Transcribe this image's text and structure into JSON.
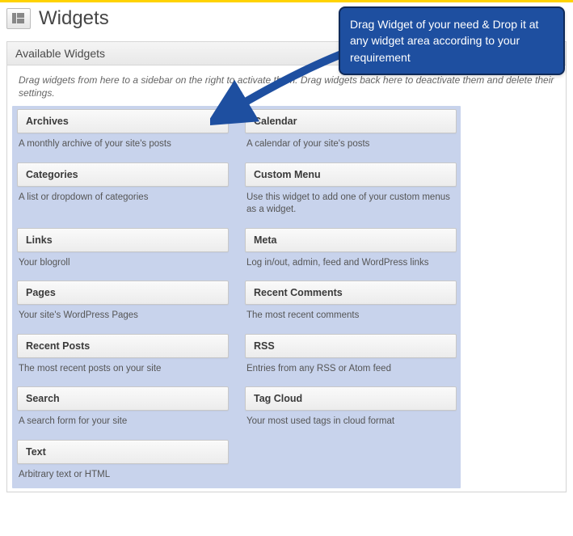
{
  "header": {
    "title": "Widgets"
  },
  "panel": {
    "title": "Available Widgets",
    "description": "Drag widgets from here to a sidebar on the right to activate them. Drag widgets back here to deactivate them and delete their settings."
  },
  "callout": {
    "text": "Drag Widget of your need & Drop it at any widget area according to your requirement"
  },
  "widgets": [
    {
      "title": "Archives",
      "desc": "A monthly archive of your site's posts"
    },
    {
      "title": "Calendar",
      "desc": "A calendar of your site's posts"
    },
    {
      "title": "Categories",
      "desc": "A list or dropdown of categories"
    },
    {
      "title": "Custom Menu",
      "desc": "Use this widget to add one of your custom menus as a widget."
    },
    {
      "title": "Links",
      "desc": "Your blogroll"
    },
    {
      "title": "Meta",
      "desc": "Log in/out, admin, feed and WordPress links"
    },
    {
      "title": "Pages",
      "desc": "Your site's WordPress Pages"
    },
    {
      "title": "Recent Comments",
      "desc": "The most recent comments"
    },
    {
      "title": "Recent Posts",
      "desc": "The most recent posts on your site"
    },
    {
      "title": "RSS",
      "desc": "Entries from any RSS or Atom feed"
    },
    {
      "title": "Search",
      "desc": "A search form for your site"
    },
    {
      "title": "Tag Cloud",
      "desc": "Your most used tags in cloud format"
    },
    {
      "title": "Text",
      "desc": "Arbitrary text or HTML"
    }
  ]
}
